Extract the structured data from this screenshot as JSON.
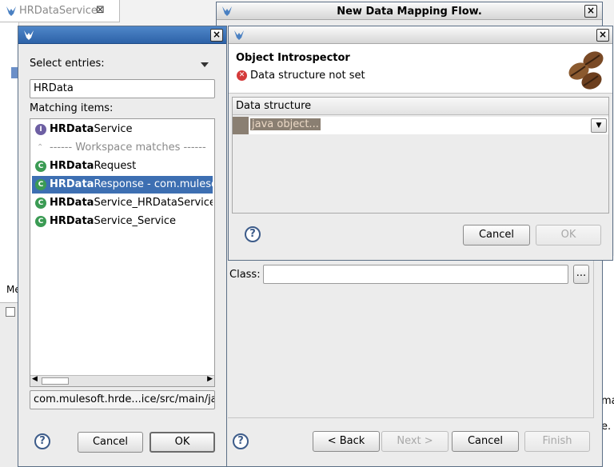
{
  "background": {
    "tab_title": "HRDataService",
    "tab_close": "⊠",
    "fragment_me": "Me",
    "fragment_ma": "ma",
    "fragment_e": "e."
  },
  "mapping_dialog": {
    "title": "New Data Mapping Flow.",
    "close": "×",
    "class_label": "Class:",
    "class_value": "",
    "browse_label": "...",
    "help": "?",
    "back_label": "< Back",
    "back_mnemonic": "B",
    "next_label": "Next >",
    "cancel_label": "Cancel",
    "finish_label": "Finish"
  },
  "introspector": {
    "close": "×",
    "heading": "Object Introspector",
    "error_text": "Data structure not set",
    "table_header": "Data structure",
    "combo_value": "java object...",
    "help": "?",
    "cancel_label": "Cancel",
    "ok_label": "OK"
  },
  "select_dialog": {
    "close": "×",
    "select_label": "Select entries:",
    "filter_value": "HRData",
    "matching_label": "Matching items:",
    "matching_mnemonic": "M",
    "items": [
      {
        "icon": "I",
        "bold": "HRData",
        "rest": "Service",
        "selected": false
      },
      {
        "icon": "",
        "bold": "",
        "rest": "------ Workspace matches ------",
        "selected": false
      },
      {
        "icon": "C",
        "bold": "HRData",
        "rest": "Request",
        "selected": false
      },
      {
        "icon": "C",
        "bold": "HRData",
        "rest": "Response - com.mulesoft.",
        "selected": true
      },
      {
        "icon": "C",
        "bold": "HRData",
        "rest": "Service_HRDataServiceSO",
        "selected": false
      },
      {
        "icon": "C",
        "bold": "HRData",
        "rest": "Service_Service",
        "selected": false
      }
    ],
    "status_path": "com.mulesoft.hrde...ice/src/main/java",
    "help": "?",
    "cancel_label": "Cancel",
    "ok_label": "OK"
  }
}
